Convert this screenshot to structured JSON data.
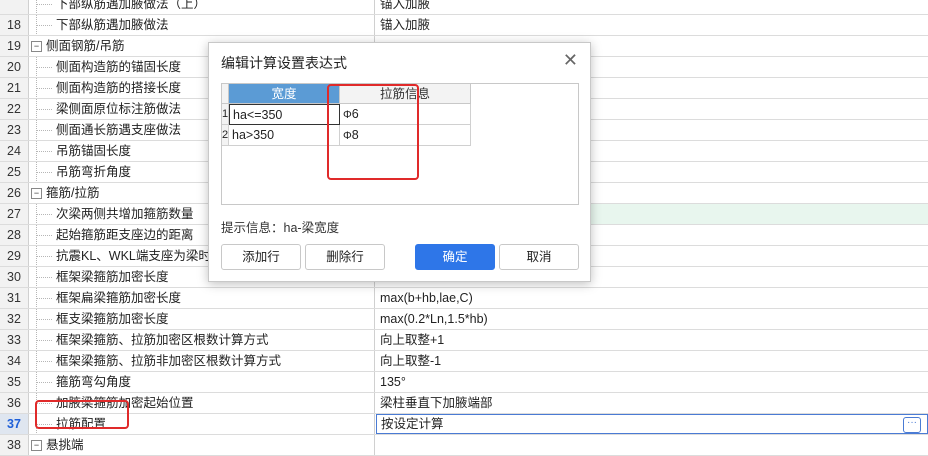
{
  "rows": [
    {
      "num": "",
      "name": "下部纵筋遇加腋做法（上）",
      "value": "锚入加腋",
      "type": "child"
    },
    {
      "num": "18",
      "name": "下部纵筋遇加腋做法",
      "value": "锚入加腋",
      "type": "child"
    },
    {
      "num": "19",
      "name": "侧面钢筋/吊筋",
      "value": "",
      "type": "group"
    },
    {
      "num": "20",
      "name": "侧面构造筋的锚固长度",
      "value": "",
      "type": "child"
    },
    {
      "num": "21",
      "name": "侧面构造筋的搭接长度",
      "value": "",
      "type": "child"
    },
    {
      "num": "22",
      "name": "梁侧面原位标注筋做法",
      "value": "",
      "type": "child"
    },
    {
      "num": "23",
      "name": "侧面通长筋遇支座做法",
      "value": "",
      "type": "child"
    },
    {
      "num": "24",
      "name": "吊筋锚固长度",
      "value": "",
      "type": "child"
    },
    {
      "num": "25",
      "name": "吊筋弯折角度",
      "value": "",
      "type": "child"
    },
    {
      "num": "26",
      "name": "箍筋/拉筋",
      "value": "",
      "type": "group"
    },
    {
      "num": "27",
      "name": "次梁两侧共增加箍筋数量",
      "value": "",
      "type": "child",
      "green": true
    },
    {
      "num": "28",
      "name": "起始箍筋距支座边的距离",
      "value": "",
      "type": "child"
    },
    {
      "num": "29",
      "name": "抗震KL、WKL端支座为梁时，",
      "value": "",
      "type": "child"
    },
    {
      "num": "30",
      "name": "框架梁箍筋加密长度",
      "value": "",
      "type": "child"
    },
    {
      "num": "31",
      "name": "框架扁梁箍筋加密长度",
      "value": "max(b+hb,lae,C)",
      "type": "child"
    },
    {
      "num": "32",
      "name": "框支梁箍筋加密长度",
      "value": "max(0.2*Ln,1.5*hb)",
      "type": "child"
    },
    {
      "num": "33",
      "name": "框架梁箍筋、拉筋加密区根数计算方式",
      "value": "向上取整+1",
      "type": "child"
    },
    {
      "num": "34",
      "name": "框架梁箍筋、拉筋非加密区根数计算方式",
      "value": "向上取整-1",
      "type": "child"
    },
    {
      "num": "35",
      "name": "箍筋弯勾角度",
      "value": "135°",
      "type": "child"
    },
    {
      "num": "36",
      "name": "加腋梁箍筋加密起始位置",
      "value": "梁柱垂直下加腋端部",
      "type": "child"
    },
    {
      "num": "37",
      "name": "拉筋配置",
      "value": "按设定计算",
      "type": "child",
      "selected": true
    },
    {
      "num": "38",
      "name": "悬挑端",
      "value": "",
      "type": "group"
    }
  ],
  "more_label": "···",
  "expander_symbol": "−",
  "dialog": {
    "title": "编辑计算设置表达式",
    "close": "✕",
    "col1": "宽度",
    "col2": "拉筋信息",
    "table": [
      {
        "rn": "1",
        "width": "ha<=350",
        "rebar": "6"
      },
      {
        "rn": "2",
        "width": "ha>350",
        "rebar": "8"
      }
    ],
    "rebar_symbol": "Φ",
    "hint": "提示信息：ha-梁宽度",
    "add_btn": "添加行",
    "del_btn": "删除行",
    "ok_btn": "确定",
    "cancel_btn": "取消"
  }
}
